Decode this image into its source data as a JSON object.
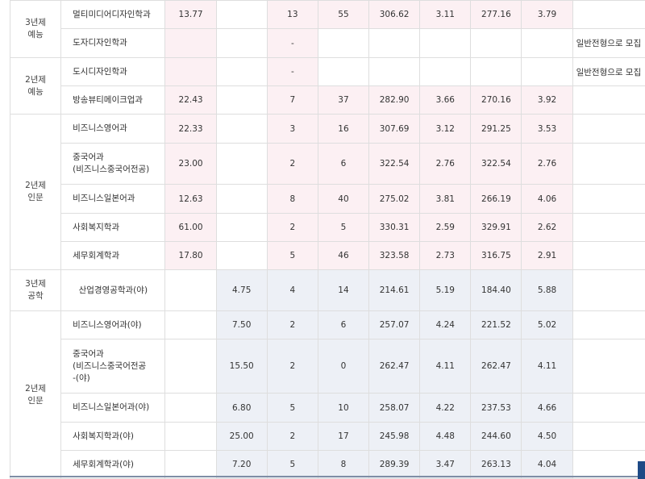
{
  "table": {
    "rows": [
      {
        "category": "3년제\n예능",
        "dept": "멀티미디어디자인학과",
        "c1": "13.77",
        "c2": "",
        "c3": "13",
        "c4": "55",
        "c5": "306.62",
        "c6": "3.11",
        "c7": "277.16",
        "c8": "3.79",
        "note": ""
      },
      {
        "dept": "도자디자인학과",
        "c1": "",
        "c2": "",
        "c3": "-",
        "c4": "",
        "c5": "",
        "c6": "",
        "c7": "",
        "c8": "",
        "note": "일반전형으로 모집"
      },
      {
        "category": "2년제\n예능",
        "dept": "도시디자인학과",
        "c1": "",
        "c2": "",
        "c3": "-",
        "c4": "",
        "c5": "",
        "c6": "",
        "c7": "",
        "c8": "",
        "note": "일반전형으로 모집"
      },
      {
        "dept": "방송뷰티메이크업과",
        "c1": "22.43",
        "c2": "",
        "c3": "7",
        "c4": "37",
        "c5": "282.90",
        "c6": "3.66",
        "c7": "270.16",
        "c8": "3.92",
        "note": ""
      },
      {
        "category": "2년제\n인문",
        "dept": "비즈니스영어과",
        "c1": "22.33",
        "c2": "",
        "c3": "3",
        "c4": "16",
        "c5": "307.69",
        "c6": "3.12",
        "c7": "291.25",
        "c8": "3.53",
        "note": ""
      },
      {
        "dept": "중국어과\n(비즈니스중국어전공)",
        "c1": "23.00",
        "c2": "",
        "c3": "2",
        "c4": "6",
        "c5": "322.54",
        "c6": "2.76",
        "c7": "322.54",
        "c8": "2.76",
        "note": ""
      },
      {
        "dept": "비즈니스일본어과",
        "c1": "12.63",
        "c2": "",
        "c3": "8",
        "c4": "40",
        "c5": "275.02",
        "c6": "3.81",
        "c7": "266.19",
        "c8": "4.06",
        "note": ""
      },
      {
        "dept": "사회복지학과",
        "c1": "61.00",
        "c2": "",
        "c3": "2",
        "c4": "5",
        "c5": "330.31",
        "c6": "2.59",
        "c7": "329.91",
        "c8": "2.62",
        "note": ""
      },
      {
        "dept": "세무회계학과",
        "c1": "17.80",
        "c2": "",
        "c3": "5",
        "c4": "46",
        "c5": "323.58",
        "c6": "2.73",
        "c7": "316.75",
        "c8": "2.91",
        "note": ""
      },
      {
        "category": "3년제\n공학",
        "dept": "산업경영공학과(야)",
        "c1": "",
        "c2": "4.75",
        "c3": "4",
        "c4": "14",
        "c5": "214.61",
        "c6": "5.19",
        "c7": "184.40",
        "c8": "5.88",
        "note": ""
      },
      {
        "category": "2년제\n인문",
        "dept": "비즈니스영어과(야)",
        "c1": "",
        "c2": "7.50",
        "c3": "2",
        "c4": "6",
        "c5": "257.07",
        "c6": "4.24",
        "c7": "221.52",
        "c8": "5.02",
        "note": ""
      },
      {
        "dept": "중국어과\n(비즈니스중국어전공\n-(야)",
        "c1": "",
        "c2": "15.50",
        "c3": "2",
        "c4": "0",
        "c5": "262.47",
        "c6": "4.11",
        "c7": "262.47",
        "c8": "4.11",
        "note": ""
      },
      {
        "dept": "비즈니스일본어과(야)",
        "c1": "",
        "c2": "6.80",
        "c3": "5",
        "c4": "10",
        "c5": "258.07",
        "c6": "4.22",
        "c7": "237.53",
        "c8": "4.66",
        "note": ""
      },
      {
        "dept": "사회복지학과(야)",
        "c1": "",
        "c2": "25.00",
        "c3": "2",
        "c4": "17",
        "c5": "245.98",
        "c6": "4.48",
        "c7": "244.60",
        "c8": "4.50",
        "note": ""
      },
      {
        "dept": "세무회계학과(야)",
        "c1": "",
        "c2": "7.20",
        "c3": "5",
        "c4": "8",
        "c5": "289.39",
        "c6": "3.47",
        "c7": "263.13",
        "c8": "4.04",
        "note": ""
      }
    ]
  },
  "colors": {
    "day_shade": "#fcf0f3",
    "night_shade": "#edf0f6",
    "border": "#dedede",
    "corner_mark": "#1e4a86"
  }
}
